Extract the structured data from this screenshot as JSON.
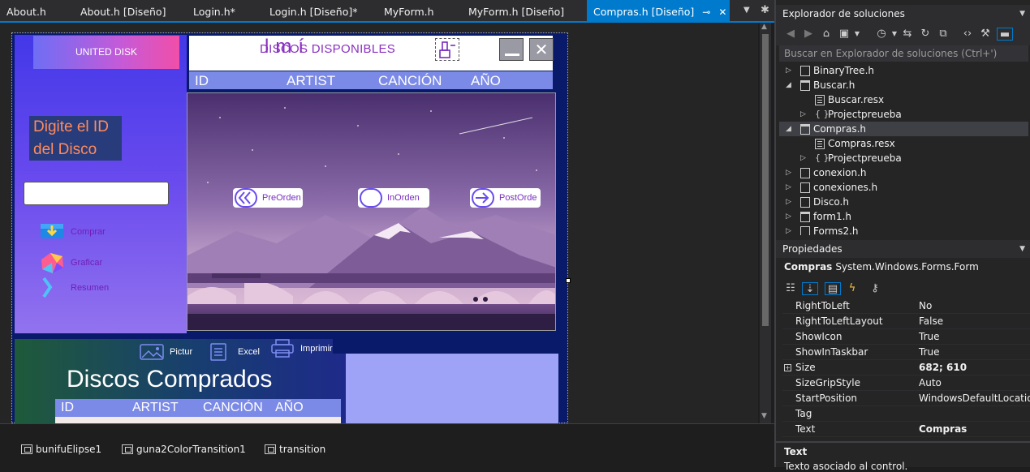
{
  "tabs": [
    {
      "label": "About.h",
      "active": false
    },
    {
      "label": "About.h [Diseño]",
      "active": false
    },
    {
      "label": "Login.h*",
      "active": false
    },
    {
      "label": "Login.h [Diseño]*",
      "active": false
    },
    {
      "label": "MyForm.h",
      "active": false
    },
    {
      "label": "MyForm.h [Diseño]",
      "active": false
    },
    {
      "label": "Compras.h [Diseño]",
      "active": true
    }
  ],
  "form": {
    "logo_text": "UNITED DISK",
    "title_deco": "lmí",
    "title": "DISCOS DISPONIBLES",
    "prompt_line1": "Digite el ID",
    "prompt_line2": "del Disco",
    "id_input_value": "",
    "nav": [
      {
        "label": "Comprar",
        "icon": "cart-icon"
      },
      {
        "label": "Graficar",
        "icon": "chart-icon"
      },
      {
        "label": "Resumen",
        "icon": "chevron-right-icon"
      }
    ],
    "columns": [
      "ID",
      "ARTIST",
      "CANCIÓN",
      "AÑO"
    ],
    "traversals": [
      {
        "label": "PreOrden",
        "icon": "double-chevron-left-icon"
      },
      {
        "label": "InOrden",
        "icon": "circle-icon"
      },
      {
        "label": "PostOrde",
        "icon": "arrow-right-icon"
      }
    ],
    "bottom": {
      "title": "Discos Comprados",
      "tools": [
        {
          "label": "Pictur",
          "icon": "picture-icon"
        },
        {
          "label": "Excel",
          "icon": "document-icon"
        },
        {
          "label": "Imprimir",
          "icon": "printer-icon"
        }
      ],
      "columns": [
        "ID",
        "ARTIST",
        "CANCIÓN",
        "AÑO"
      ]
    }
  },
  "tray": [
    {
      "label": "bunifuElipse1"
    },
    {
      "label": "guna2ColorTransition1"
    },
    {
      "label": "transition"
    }
  ],
  "solution_explorer": {
    "title": "Explorador de soluciones",
    "search_placeholder": "Buscar en Explorador de soluciones (Ctrl+')",
    "items": [
      {
        "label": "BinaryTree.h",
        "indent": 1,
        "kind": "file",
        "arrow": "right",
        "selected": false
      },
      {
        "label": "Buscar.h",
        "indent": 1,
        "kind": "form",
        "arrow": "down",
        "selected": false
      },
      {
        "label": "Buscar.resx",
        "indent": 2,
        "kind": "resx",
        "arrow": "",
        "selected": false
      },
      {
        "label": "Projectpreueba",
        "indent": 2,
        "kind": "namespace",
        "arrow": "right",
        "selected": false
      },
      {
        "label": "Compras.h",
        "indent": 1,
        "kind": "form",
        "arrow": "down",
        "selected": true
      },
      {
        "label": "Compras.resx",
        "indent": 2,
        "kind": "resx",
        "arrow": "",
        "selected": false
      },
      {
        "label": "Projectpreueba",
        "indent": 2,
        "kind": "namespace",
        "arrow": "right",
        "selected": false
      },
      {
        "label": "conexion.h",
        "indent": 1,
        "kind": "file",
        "arrow": "right",
        "selected": false
      },
      {
        "label": "conexiones.h",
        "indent": 1,
        "kind": "file",
        "arrow": "right",
        "selected": false
      },
      {
        "label": "Disco.h",
        "indent": 1,
        "kind": "file",
        "arrow": "right",
        "selected": false
      },
      {
        "label": "form1.h",
        "indent": 1,
        "kind": "form",
        "arrow": "right",
        "selected": false
      },
      {
        "label": "Forms2.h",
        "indent": 1,
        "kind": "file",
        "arrow": "right",
        "selected": false
      }
    ]
  },
  "properties": {
    "title": "Propiedades",
    "object_name": "Compras",
    "object_type": "System.Windows.Forms.Form",
    "rows": [
      {
        "name": "RightToLeft",
        "value": "No",
        "bold": false,
        "expandable": false
      },
      {
        "name": "RightToLeftLayout",
        "value": "False",
        "bold": false,
        "expandable": false
      },
      {
        "name": "ShowIcon",
        "value": "True",
        "bold": false,
        "expandable": false
      },
      {
        "name": "ShowInTaskbar",
        "value": "True",
        "bold": false,
        "expandable": false
      },
      {
        "name": "Size",
        "value": "682; 610",
        "bold": true,
        "expandable": true
      },
      {
        "name": "SizeGripStyle",
        "value": "Auto",
        "bold": false,
        "expandable": false
      },
      {
        "name": "StartPosition",
        "value": "WindowsDefaultLocation",
        "bold": false,
        "expandable": false
      },
      {
        "name": "Tag",
        "value": "",
        "bold": false,
        "expandable": false
      },
      {
        "name": "Text",
        "value": "Compras",
        "bold": true,
        "expandable": false
      }
    ],
    "description_title": "Text",
    "description_text": "Texto asociado al control."
  }
}
